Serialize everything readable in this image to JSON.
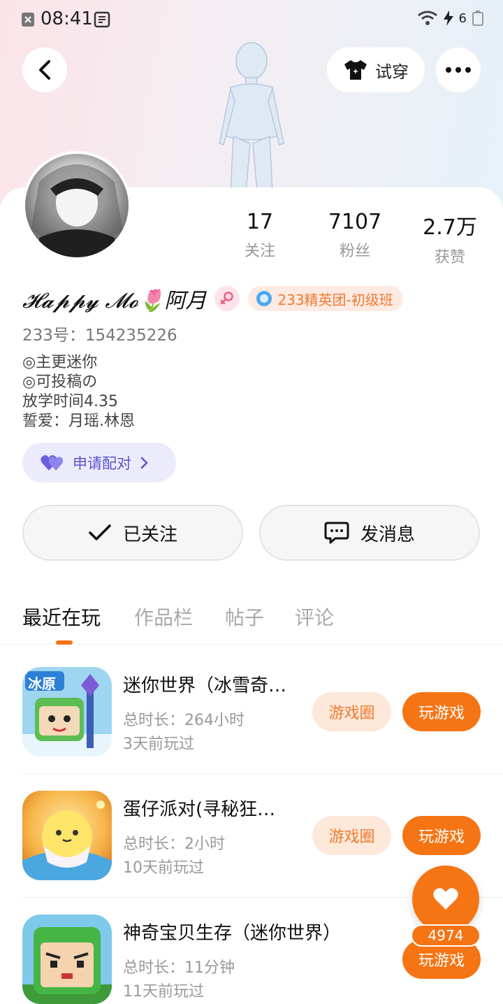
{
  "status_bar": {
    "time": "08:41",
    "battery_level": "6"
  },
  "header": {
    "try_on_label": "试穿"
  },
  "profile": {
    "name": "𝓗𝓪𝓹𝓹𝔂 𝓜𝓸🌷阿月",
    "group_badge": "233精英团-初级班",
    "uid": "233号：154235226",
    "bio": [
      "◎主更迷你",
      "◎可投稿の",
      "放学时间4.35",
      "誓爱：月瑶.林恩"
    ],
    "pair_label": "申请配对"
  },
  "stats": [
    {
      "value": "17",
      "label": "关注"
    },
    {
      "value": "7107",
      "label": "粉丝"
    },
    {
      "value": "2.7万",
      "label": "获赞"
    }
  ],
  "actions": {
    "follow_label": "已关注",
    "message_label": "发消息"
  },
  "tabs": [
    "最近在玩",
    "作品栏",
    "帖子",
    "评论"
  ],
  "games": [
    {
      "title": "迷你世界（冰雪奇…",
      "duration": "总时长：264小时",
      "last_played": "3天前玩过",
      "circle_label": "游戏圈",
      "play_label": "玩游戏",
      "icon_label": "冰原"
    },
    {
      "title": "蛋仔派对(寻秘狂…",
      "duration": "总时长：2小时",
      "last_played": "10天前玩过",
      "circle_label": "游戏圈",
      "play_label": "玩游戏"
    },
    {
      "title": "神奇宝贝生存（迷你世界）",
      "duration": "总时长：11分钟",
      "last_played": "11天前玩过",
      "play_label": "玩游戏"
    }
  ],
  "like": {
    "count": "4974"
  },
  "colors": {
    "accent": "#f57414",
    "accent_light": "#fde8d9",
    "pair_bg": "#ecebfb",
    "pair_text": "#5b55c9"
  }
}
